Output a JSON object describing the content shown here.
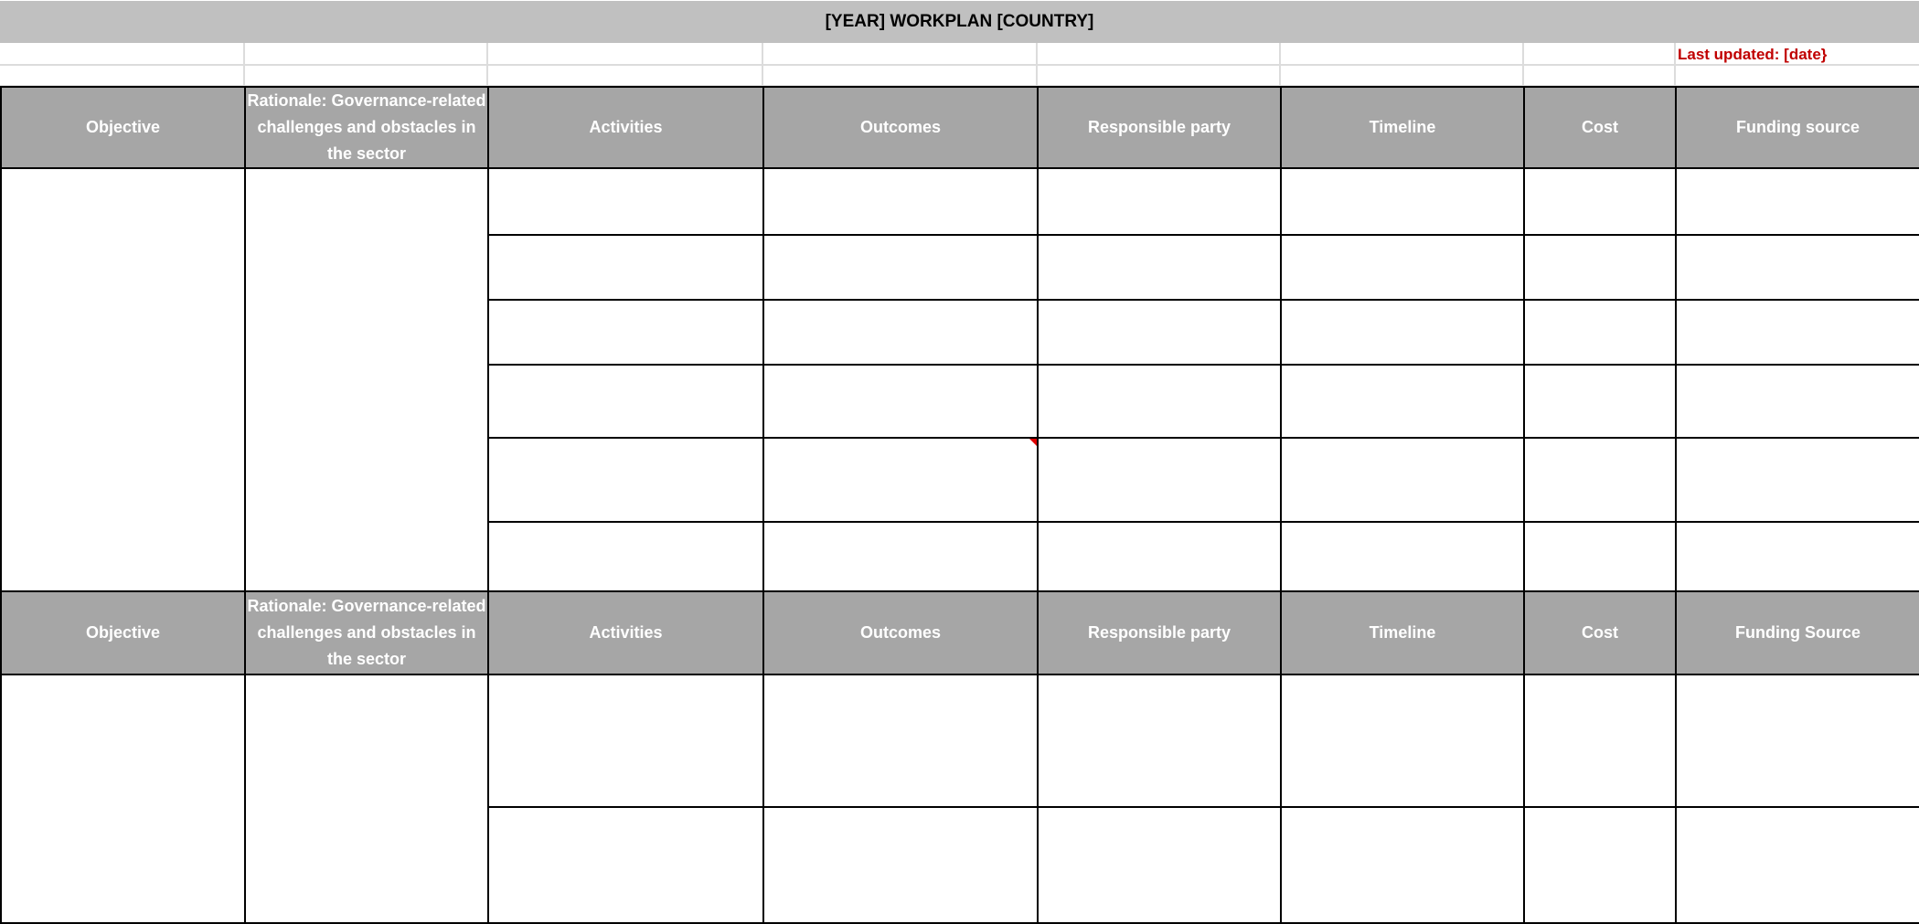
{
  "document": {
    "title": "[YEAR] WORKPLAN [COUNTRY]",
    "last_updated": "Last updated: [date}",
    "accent_color": "#c00000",
    "header_bg": "#a6a6a6"
  },
  "section1": {
    "headers": [
      "Objective",
      "Rationale: Governance-related challenges and obstacles in the sector",
      "Activities",
      "Outcomes",
      "Responsible party",
      "Timeline",
      "Cost",
      "Funding source"
    ],
    "rows": [
      [
        "",
        "",
        "",
        "",
        "",
        "",
        "",
        ""
      ],
      [
        "",
        "",
        "",
        "",
        "",
        ""
      ],
      [
        "",
        "",
        "",
        "",
        "",
        ""
      ],
      [
        "",
        "",
        "",
        "",
        "",
        ""
      ],
      [
        "",
        "",
        "",
        "",
        "",
        ""
      ],
      [
        "",
        "",
        "",
        "",
        "",
        ""
      ]
    ]
  },
  "section2": {
    "headers": [
      "Objective",
      "Rationale: Governance-related challenges and obstacles in the sector",
      "Activities",
      "Outcomes",
      "Responsible party",
      "Timeline",
      "Cost",
      "Funding Source"
    ],
    "rows": [
      [
        "",
        "",
        "",
        "",
        "",
        "",
        "",
        ""
      ],
      [
        "",
        "",
        "",
        "",
        "",
        ""
      ]
    ]
  }
}
